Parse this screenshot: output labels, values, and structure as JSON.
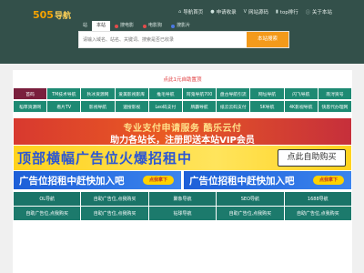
{
  "header": {
    "logo": {
      "main": "505",
      "suffix": "导航"
    },
    "nav": [
      {
        "icon": "home-icon",
        "label": "导航首页"
      },
      {
        "icon": "pin-icon",
        "label": "申请收录"
      },
      {
        "icon": "code-icon",
        "label": "网站源码"
      },
      {
        "icon": "chart-icon",
        "label": "top排行"
      },
      {
        "icon": "info-icon",
        "label": "关于本站"
      }
    ]
  },
  "search": {
    "tabs": [
      {
        "label": "站",
        "color": ""
      },
      {
        "label": "本站",
        "color": "",
        "active": true
      },
      {
        "label": "搜电影",
        "color": "#e34b4b"
      },
      {
        "label": "电影狗",
        "color": "#e34b4b"
      },
      {
        "label": "搜影片",
        "color": "#4b78e3"
      }
    ],
    "placeholder": "请输入域名、站名、关键词、搜索是否已收录",
    "button": "本站搜索"
  },
  "promo": "点此1元自助置顶",
  "grid_row1": [
    {
      "label": "首码",
      "color": "#7a1f3d"
    },
    {
      "label": "TM技术导航",
      "color": "#1e8a73"
    },
    {
      "label": "秋冰资源网",
      "color": "#1e8a73"
    },
    {
      "label": "爱美影视影库",
      "color": "#1e8a73"
    },
    {
      "label": "推毛导航",
      "color": "#1e8a73"
    },
    {
      "label": "阿鬼导航700",
      "color": "#1e8a73"
    },
    {
      "label": "盘古导航引流",
      "color": "#1e8a73"
    },
    {
      "label": "网址导航",
      "color": "#1e8a73"
    },
    {
      "label": "闪飞导航",
      "color": "#1e8a73"
    },
    {
      "label": "南浔资号",
      "color": "#1e8a73"
    }
  ],
  "grid_row2": [
    {
      "label": "稻草资源网",
      "color": "#1e8a73"
    },
    {
      "label": "看片TV",
      "color": "#1e8a73"
    },
    {
      "label": "影视导航",
      "color": "#1e8a73"
    },
    {
      "label": "速搜影视",
      "color": "#1e8a73"
    },
    {
      "label": "Leo码支付",
      "color": "#1e8a73"
    },
    {
      "label": "牌霸导航",
      "color": "#1e8a73"
    },
    {
      "label": "纸云云码支付",
      "color": "#1e8a73"
    },
    {
      "label": "SK导航",
      "color": "#1e8a73"
    },
    {
      "label": "4K影视导航",
      "color": "#1e8a73"
    },
    {
      "label": "快思代办理网",
      "color": "#1e8a73"
    }
  ],
  "banner1": {
    "line1": "专业支付申请服务 酷乐云付",
    "line2": "助力各站长，注册即送本站VIP会员"
  },
  "banner2": {
    "text": "顶部横幅广告位火爆招租中",
    "button": "点此自助购买"
  },
  "banner3": [
    {
      "text": "广告位招租中赶快加入吧",
      "pill": "点我拿下"
    },
    {
      "text": "广告位招租中赶快加入吧",
      "pill": "点我拿下"
    }
  ],
  "links_row1": [
    "OL导航",
    "自助广告位,点我购买",
    "聚象导航",
    "SEO导航",
    "1688导航"
  ],
  "links_row2": [
    "自助广告位,点我购买",
    "自助广告位,点我购买",
    "钻球导航",
    "自助广告位,点我购买",
    "自助广告位,点我购买"
  ]
}
